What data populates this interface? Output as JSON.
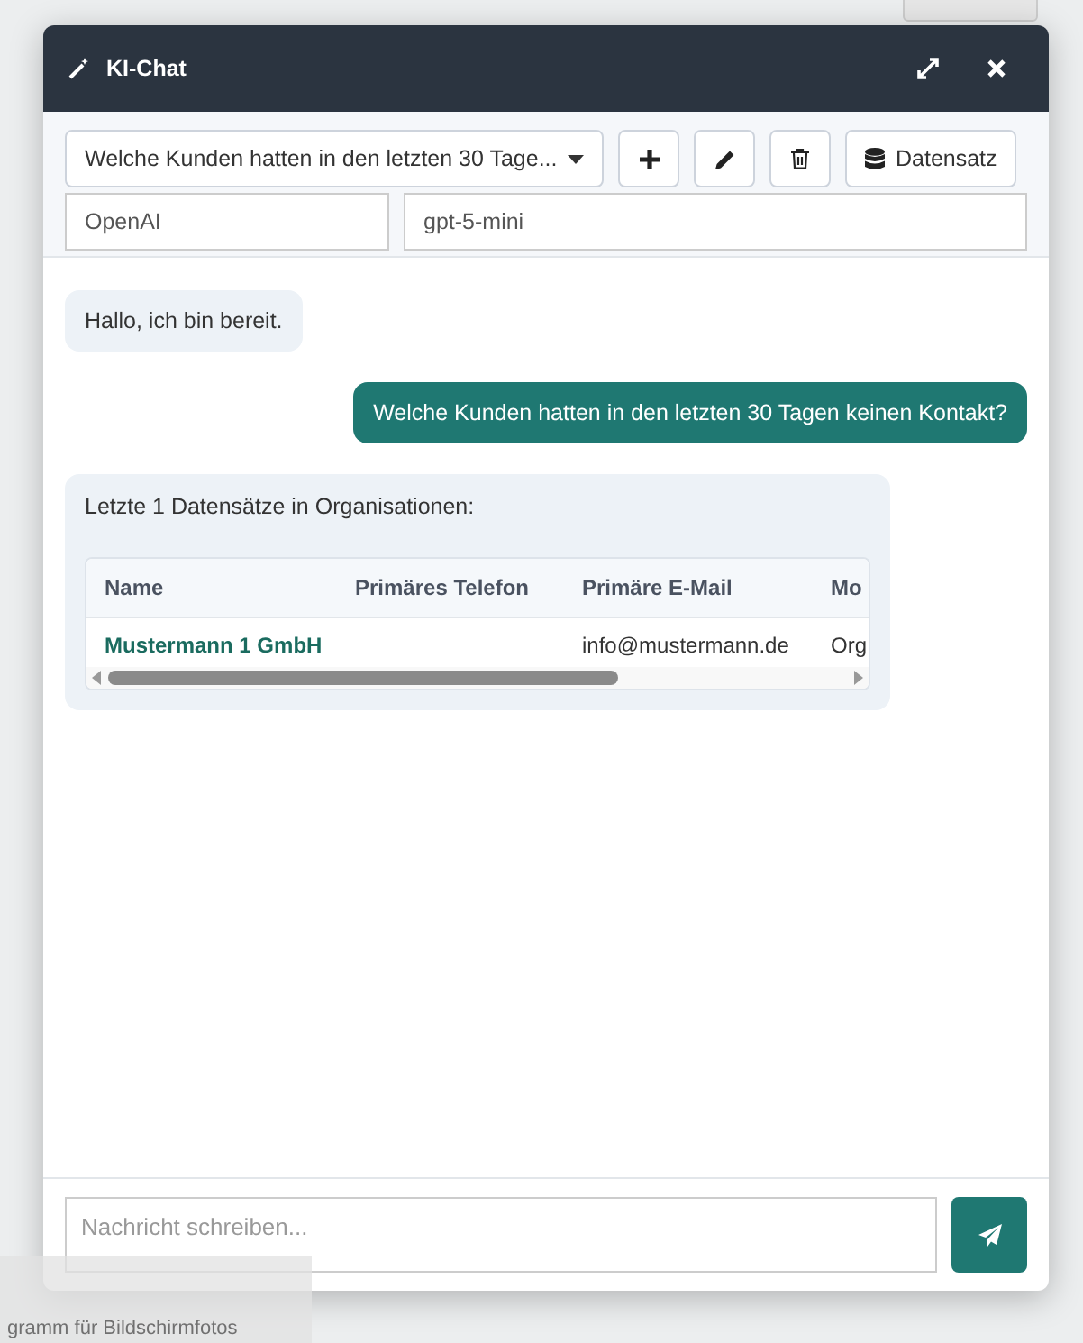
{
  "window": {
    "title": "KI-Chat"
  },
  "toolbar": {
    "conversation_select": "Welche Kunden hatten in den letzten 30 Tage...",
    "dataset_button": "Datensatz"
  },
  "model": {
    "provider": "OpenAI",
    "model": "gpt-5-mini"
  },
  "messages": [
    {
      "from_user": false,
      "kind": "text",
      "text": "Hallo, ich bin bereit."
    },
    {
      "from_user": true,
      "kind": "text",
      "text": "Welche Kunden hatten in den letzten 30 Tagen keinen Kontakt?"
    },
    {
      "from_user": false,
      "kind": "table",
      "text": "Letzte 1 Datensätze in Organisationen:",
      "table": {
        "columns": [
          "Name",
          "Primäres Telefon",
          "Primäre E-Mail",
          "Mo"
        ],
        "rows": [
          {
            "name": "Mustermann 1 GmbH",
            "email": "info@mustermann.de",
            "column_4": "Org"
          }
        ]
      }
    }
  ],
  "composer": {
    "placeholder": "Nachricht schreiben..."
  },
  "notification": {
    "text": "gramm für Bildschirmfotos"
  }
}
